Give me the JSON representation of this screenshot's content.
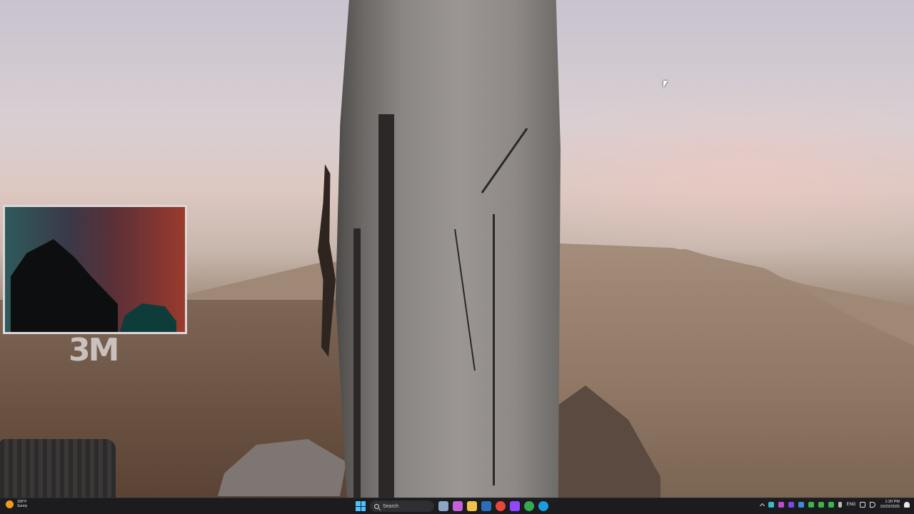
{
  "overlay": {
    "logo_text": "3M"
  },
  "taskbar": {
    "weather": {
      "temp": "100°F",
      "condition": "Sunny"
    },
    "search_placeholder": "Search",
    "pinned": [
      {
        "name": "search-highlight-icon",
        "color": "#8da4c9"
      },
      {
        "name": "copilot-icon",
        "color": "#c561d8"
      },
      {
        "name": "file-explorer-icon",
        "color": "#f2c14e"
      },
      {
        "name": "steam-icon",
        "color": "#2a6fb5"
      },
      {
        "name": "chrome-icon",
        "color": "#e8453c"
      },
      {
        "name": "twitch-icon",
        "color": "#9146ff"
      },
      {
        "name": "chrome-alt-icon",
        "color": "#34a853"
      },
      {
        "name": "edge-icon",
        "color": "#1a9ce0"
      }
    ],
    "tray": {
      "language": "ENG",
      "time": "1:20 PM",
      "date": "10/23/2025"
    }
  }
}
